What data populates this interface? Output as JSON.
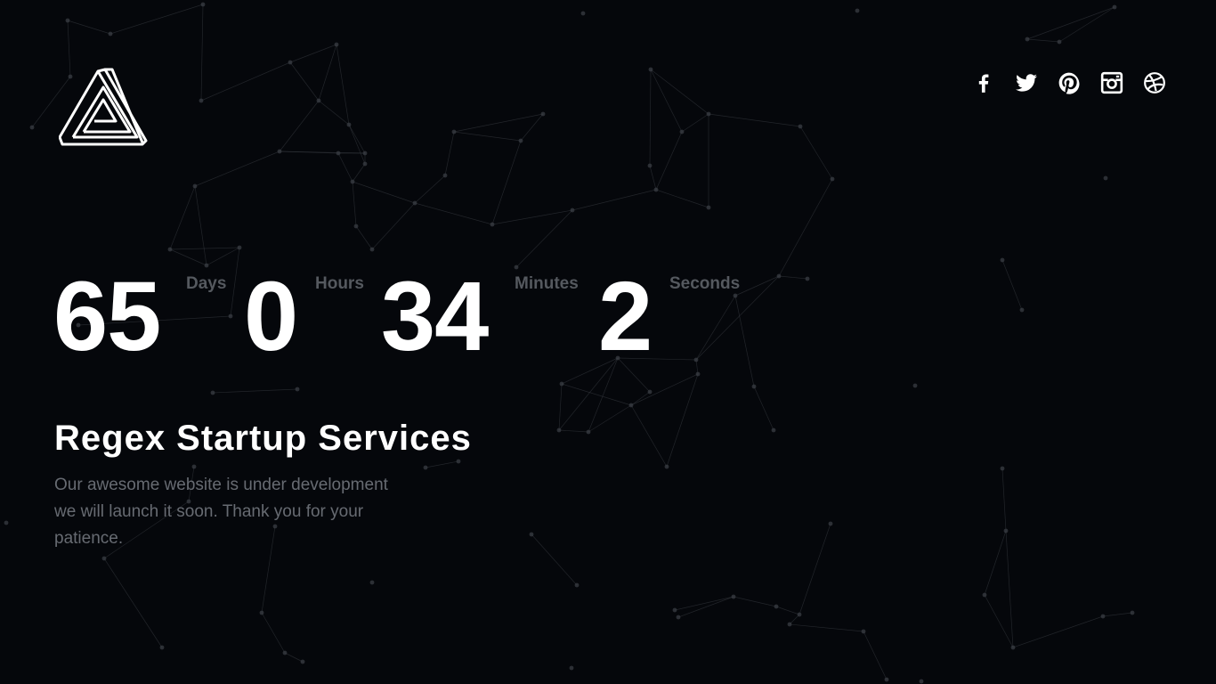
{
  "brand": {
    "logo_icon": "penrose-triangle-icon"
  },
  "social": [
    {
      "name": "facebook",
      "icon": "facebook-icon"
    },
    {
      "name": "twitter",
      "icon": "twitter-icon"
    },
    {
      "name": "pinterest",
      "icon": "pinterest-icon"
    },
    {
      "name": "instagram",
      "icon": "instagram-icon"
    },
    {
      "name": "dribbble",
      "icon": "dribbble-icon"
    }
  ],
  "countdown": {
    "days": {
      "value": "65",
      "label": "Days"
    },
    "hours": {
      "value": "0",
      "label": "Hours"
    },
    "minutes": {
      "value": "34",
      "label": "Minutes"
    },
    "seconds": {
      "value": "2",
      "label": "Seconds"
    }
  },
  "hero": {
    "title": "Regex Startup Services",
    "description": "Our awesome website is under development we will launch it soon. Thank you for your patience."
  },
  "colors": {
    "background": "#05070b",
    "text": "#ffffff",
    "muted": "#55595f",
    "network": "#3a3e44"
  }
}
